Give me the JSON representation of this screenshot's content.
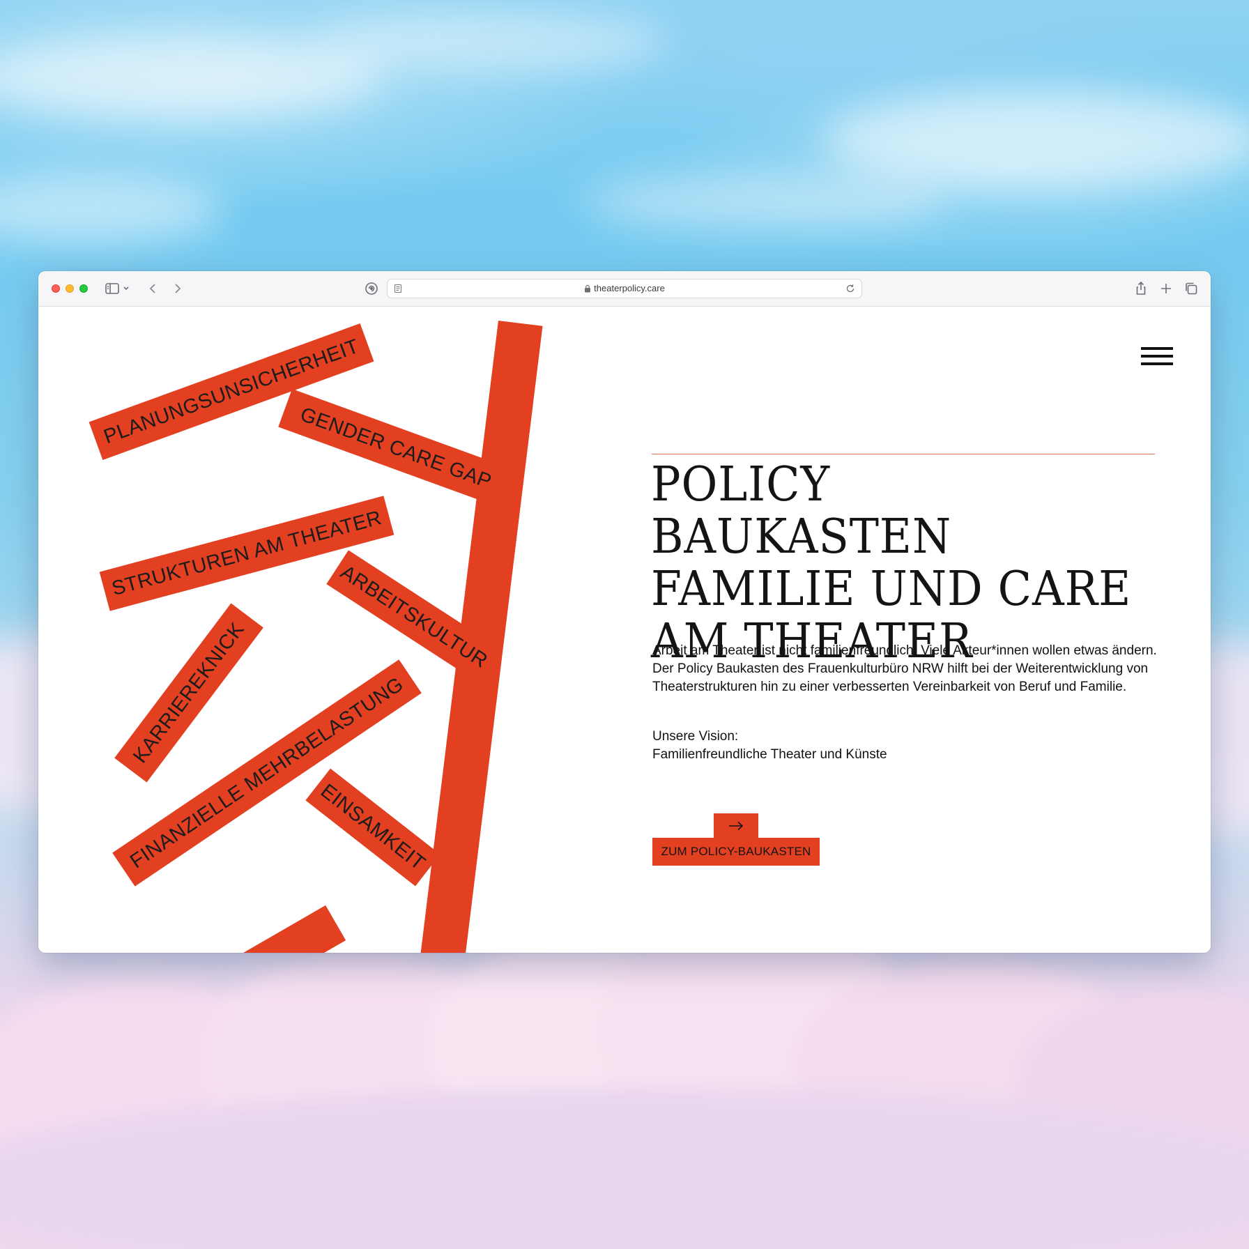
{
  "browser": {
    "url": "theaterpolicy.care"
  },
  "tags": {
    "planung": "PLANUNGSUNSICHERHEIT",
    "gender": "GENDER CARE GAP",
    "strukturen": "STRUKTUREN AM THEATER",
    "arbeitskultur": "ARBEITSKULTUR",
    "karriere": "KARRIEREKNICK",
    "finanzielle": "FINANZIELLE MEHRBELASTUNG",
    "einsamkeit": "EINSAMKEIT"
  },
  "hero": {
    "headline_line1": "POLICY BAUKASTEN",
    "headline_line2": "FAMILIE UND CARE",
    "headline_line3": "AM THEATER",
    "intro": "Arbeit am Theater ist nicht familienfreundlich. Viele Akteur*innen wollen etwas ändern. Der Policy Baukasten des Frauenkulturbüro NRW hilft bei der Weiterentwicklung von Theaterstrukturen hin zu einer verbesserten Vereinbarkeit von Beruf und Familie.",
    "vision_label": "Unsere Vision:",
    "vision_text": "Familienfreundliche Theater und Künste",
    "cta_label": "ZUM POLICY-BAUKASTEN"
  },
  "icons": {
    "menu": "hamburger-menu-icon",
    "cta": "arrow-right-icon"
  },
  "colors": {
    "accent": "#e33f21",
    "text": "#141414",
    "rule": "#e8705a"
  }
}
